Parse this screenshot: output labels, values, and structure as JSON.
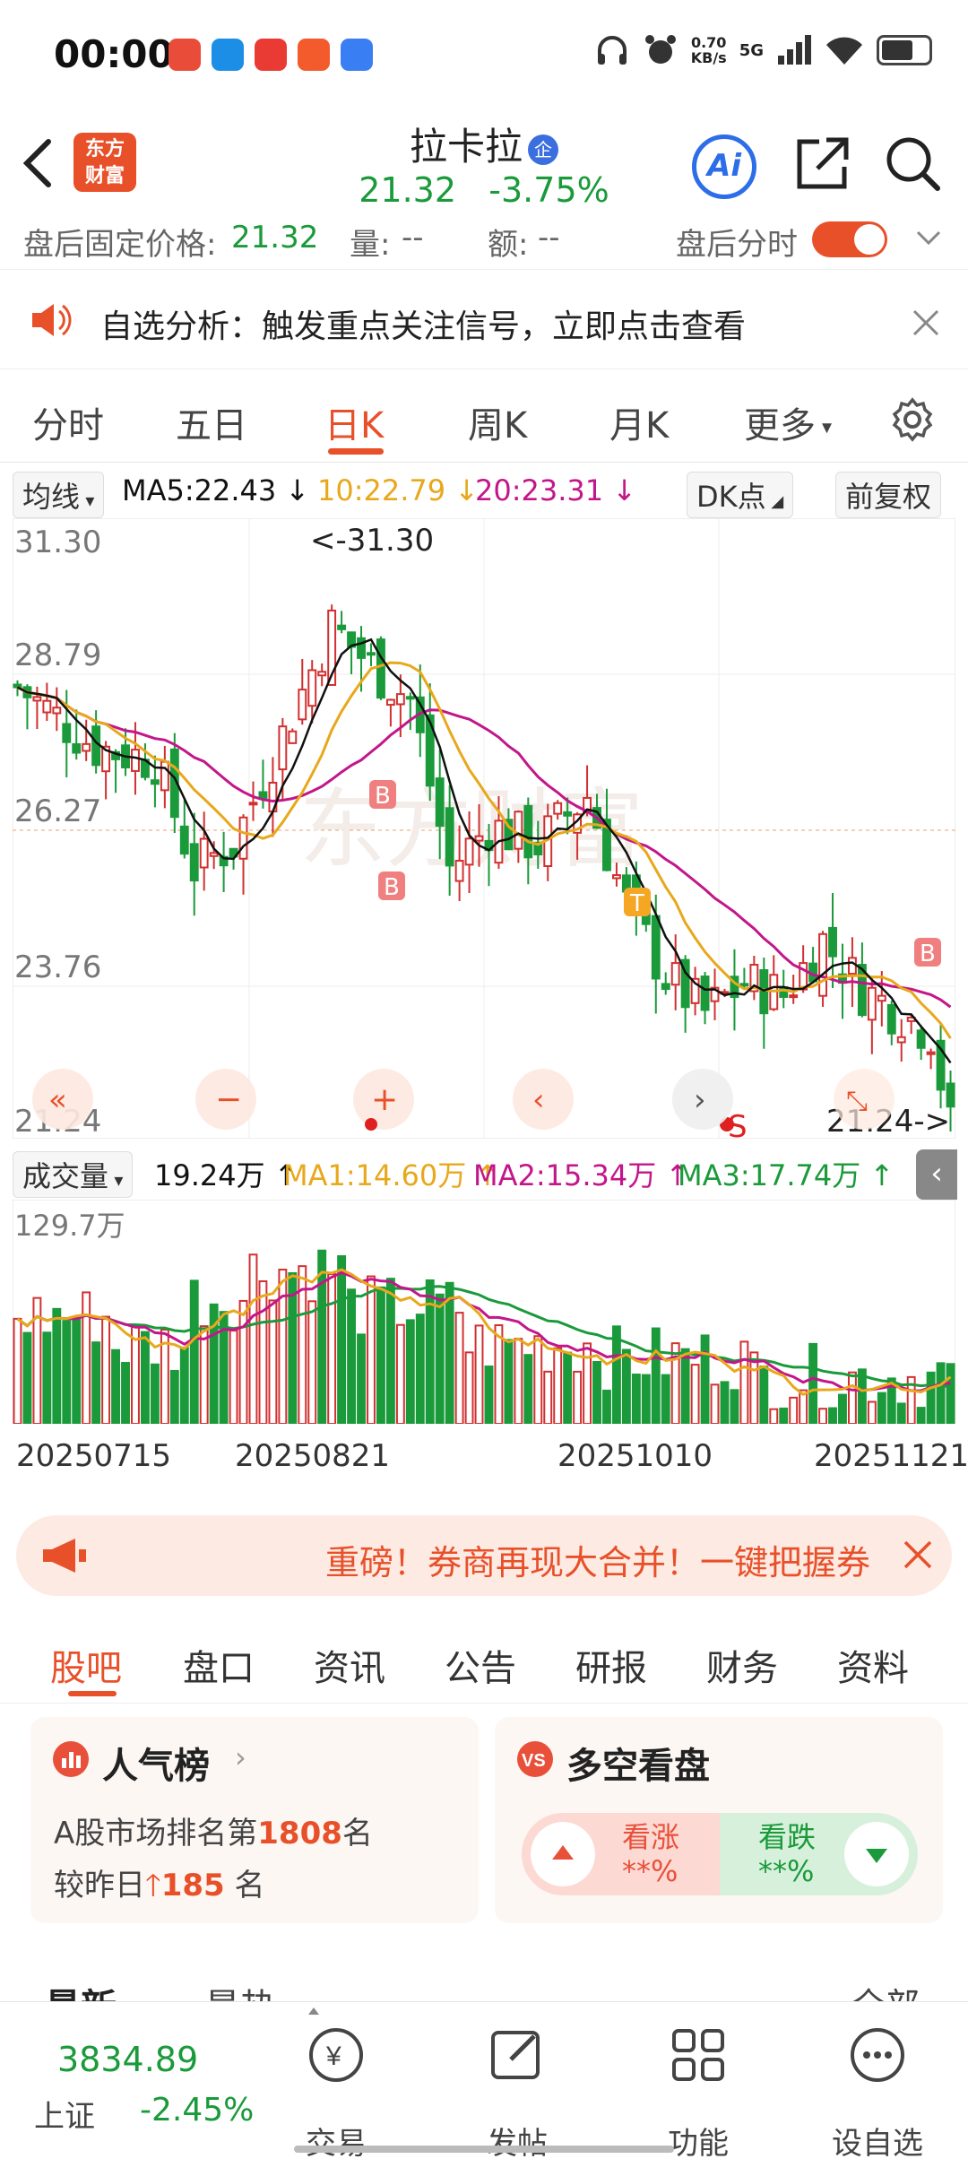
{
  "status": {
    "time": "00:00",
    "net_speed": "0.70",
    "net_unit": "KB/s",
    "signal": "5G"
  },
  "header": {
    "logo_line1": "东方",
    "logo_line2": "财富",
    "stock_name": "拉卡拉",
    "stock_badge": "企",
    "price": "21.32",
    "change_pct": "-3.75%",
    "ai_label": "Ai"
  },
  "after_hours": {
    "fixed_price_label": "盘后固定价格:",
    "fixed_price": "21.32",
    "volume_label": "量:",
    "volume_value": "--",
    "amount_label": "额:",
    "amount_value": "--",
    "timeshare_label": "盘后分时"
  },
  "notice": {
    "text": "自选分析：触发重点关注信号，立即点击查看"
  },
  "tabs": [
    {
      "label": "分时"
    },
    {
      "label": "五日"
    },
    {
      "label": "日K"
    },
    {
      "label": "周K"
    },
    {
      "label": "月K"
    },
    {
      "label": "更多"
    }
  ],
  "ma": {
    "selector": "均线",
    "ma5": "MA5:22.43",
    "ma10": "10:22.79",
    "ma20": "20:23.31",
    "dk_label": "DK点",
    "adjust_label": "前复权"
  },
  "kchart": {
    "price_labels": [
      "31.30",
      "28.79",
      "26.27",
      "23.76",
      "21.24"
    ],
    "high_marker": "<-31.30",
    "last_marker": "21.24->",
    "signals": [
      "B",
      "B",
      "T",
      "B",
      "S"
    ],
    "watermark": "东方财富"
  },
  "volume": {
    "selector": "成交量",
    "value": "19.24万",
    "ma1": "MA1:14.60万",
    "ma2": "MA2:15.34万",
    "ma3": "MA3:17.74万",
    "max_label": "129.7万"
  },
  "dates": [
    "20250715",
    "20250821",
    "20251010",
    "20251121"
  ],
  "banner": {
    "text": "重磅！券商再现大合并！一键把握券"
  },
  "subtabs": [
    {
      "label": "股吧"
    },
    {
      "label": "盘口"
    },
    {
      "label": "资讯"
    },
    {
      "label": "公告"
    },
    {
      "label": "研报"
    },
    {
      "label": "财务"
    },
    {
      "label": "资料"
    }
  ],
  "popularity": {
    "title": "人气榜",
    "rank_prefix": "A股市场排名第",
    "rank": "1808",
    "rank_suffix": "名",
    "change_prefix": "较昨日",
    "change": "185",
    "change_suffix": "名"
  },
  "sentiment": {
    "title": "多空看盘",
    "bull_label": "看涨",
    "bull_value": "**%",
    "bear_label": "看跌",
    "bear_value": "**%"
  },
  "feed_tabs": {
    "latest": "最新",
    "hot": "最热",
    "all": "全部"
  },
  "bottom_nav": {
    "index_value": "3834.89",
    "index_name": "上证",
    "index_change": "-2.45%",
    "items": [
      {
        "label": "交易"
      },
      {
        "label": "发帖"
      },
      {
        "label": "功能"
      },
      {
        "label": "设自选"
      }
    ]
  },
  "colors": {
    "up": "#d23030",
    "down": "#1a9a3a",
    "accent": "#e8502a",
    "ma5": "#111111",
    "ma10": "#e8a81c",
    "ma20": "#c3168a",
    "vol_ma3": "#1a9a3a"
  }
}
